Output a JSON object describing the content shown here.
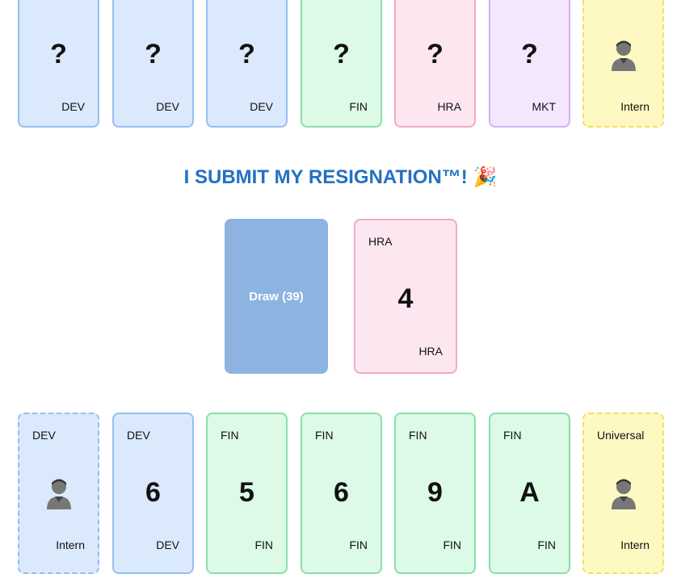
{
  "opponent_hand": [
    {
      "dept": "DEV",
      "center": "?"
    },
    {
      "dept": "DEV",
      "center": "?"
    },
    {
      "dept": "DEV",
      "center": "?"
    },
    {
      "dept": "FIN",
      "center": "?"
    },
    {
      "dept": "HRA",
      "center": "?"
    },
    {
      "dept": "MKT",
      "center": "?"
    },
    {
      "dept": "Intern",
      "center": "intern-icon"
    }
  ],
  "title": {
    "text": "I SUBMIT MY RESIGNATION™!",
    "emoji": "🎉"
  },
  "draw_pile": {
    "label": "Draw (39)"
  },
  "discard": {
    "top": "HRA",
    "value": "4",
    "bottom": "HRA"
  },
  "player_hand": [
    {
      "top": "DEV",
      "value": "intern-icon",
      "bottom": "Intern"
    },
    {
      "top": "DEV",
      "value": "6",
      "bottom": "DEV"
    },
    {
      "top": "FIN",
      "value": "5",
      "bottom": "FIN"
    },
    {
      "top": "FIN",
      "value": "6",
      "bottom": "FIN"
    },
    {
      "top": "FIN",
      "value": "9",
      "bottom": "FIN"
    },
    {
      "top": "FIN",
      "value": "A",
      "bottom": "FIN"
    },
    {
      "top": "Universal",
      "value": "intern-icon",
      "bottom": "Intern"
    }
  ],
  "colors": {
    "dev": "#dbe9fd",
    "fin": "#dcfae6",
    "hra": "#fce7f1",
    "mkt": "#f3e7fe",
    "intern": "#fef9c2",
    "title": "#2371c1"
  }
}
